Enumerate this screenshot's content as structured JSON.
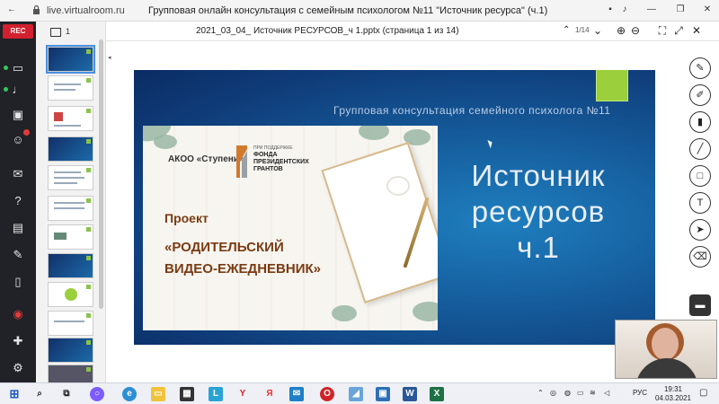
{
  "browser": {
    "url": "live.virtualroom.ru",
    "window_title": "Групповая онлайн консультация с семейным психологом №11 \"Источник ресурса\" (ч.1)"
  },
  "apptools": {
    "rec_label": "REC"
  },
  "thumbnails": {
    "page_number": "1"
  },
  "viewer": {
    "document_title": "2021_03_04_ Источник РЕСУРСОВ_ч 1.pptx (страница 1 из 14)",
    "page_counter": "1/14"
  },
  "slide": {
    "subtitle": "Групповая консультация семейного психолога №11",
    "title_line1": "Источник",
    "title_line2": "ресурсов",
    "title_line3": "ч.1",
    "org": "АКОО «Ступени»",
    "fund_small": "ПРИ ПОДДЕРЖКЕ",
    "fund_line1": "ФОНДА",
    "fund_line2": "ПРЕЗИДЕНТСКИХ",
    "fund_line3": "ГРАНТОВ",
    "project_label": "Проект",
    "project_name_line1": "«РОДИТЕЛЬСКИЙ",
    "project_name_line2": "ВИДЕО-ЕЖЕДНЕВНИК»"
  },
  "taskbar": {
    "lang": "РУС",
    "time": "19:31",
    "date": "04.03.2021"
  },
  "colors": {
    "slide_bg": "#1660a0",
    "accent_green": "#9bcf3b",
    "rec_red": "#d2202f",
    "toolbar_dark": "#202227"
  }
}
